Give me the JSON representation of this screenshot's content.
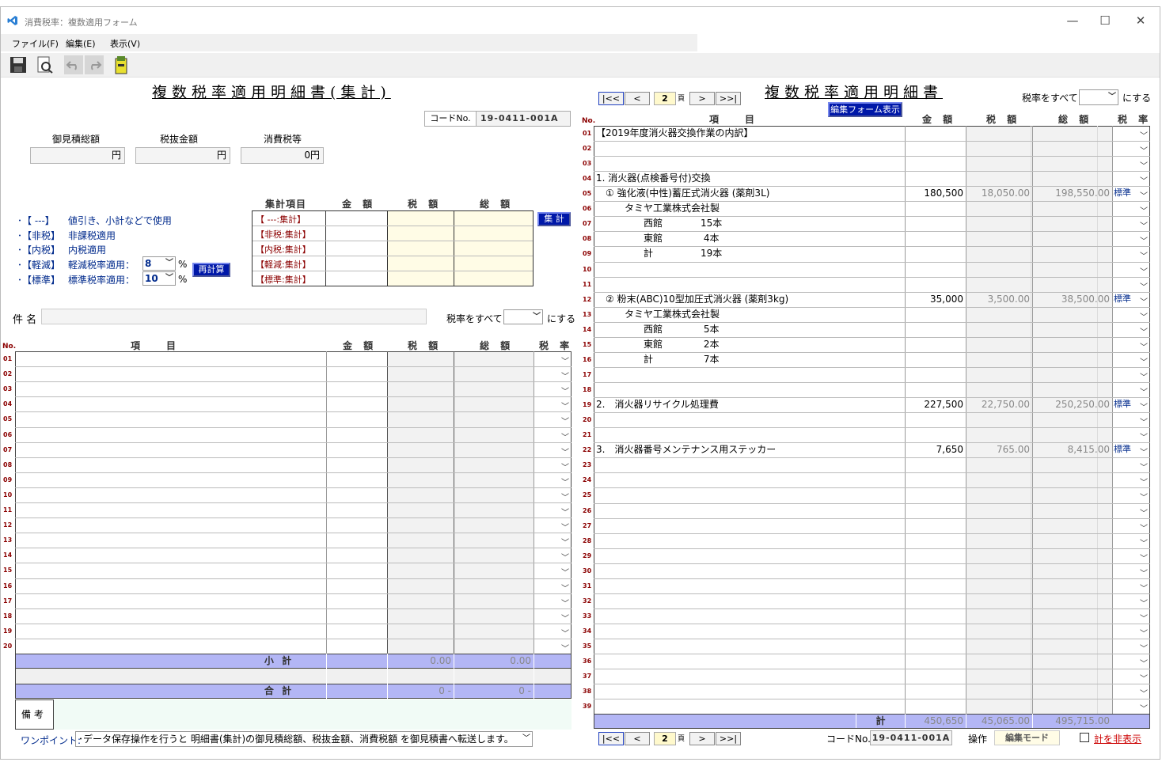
{
  "window": {
    "title": "消費税率：複数適用フォーム",
    "minimize": "—",
    "maximize": "☐",
    "close": "✕"
  },
  "menu": [
    {
      "label": "ファイル(F)"
    },
    {
      "label": "編集(E)"
    },
    {
      "label": "表示(V)"
    }
  ],
  "left": {
    "title": "複数税率適用明細書(集計)",
    "code_label": "コードNo.",
    "code_value": "19-0411-001A",
    "totals": [
      {
        "label": "御見積総額",
        "value": "円"
      },
      {
        "label": "税抜金額",
        "value": "円"
      },
      {
        "label": "消費税等",
        "value": "0円"
      }
    ],
    "legend": [
      {
        "tag": "･【 ---】",
        "desc": "値引き、小計などで使用"
      },
      {
        "tag": "･【非税】",
        "desc": "非課税適用"
      },
      {
        "tag": "･【内税】",
        "desc": "内税適用"
      },
      {
        "tag": "･【軽減】",
        "desc": "軽減税率適用："
      },
      {
        "tag": "･【標準】",
        "desc": "標準税率適用："
      }
    ],
    "reduced_rate": "8",
    "standard_rate": "10",
    "percent": "%",
    "recalc_button": "再計算",
    "summary": {
      "headers": [
        "集計項目",
        "金 額",
        "税 額",
        "総 額"
      ],
      "rows": [
        "【 ---:集計】",
        "【非税:集計】",
        "【内税:集計】",
        "【軽減:集計】",
        "【標準:集計】"
      ],
      "button": "集 計"
    },
    "subject_label": "件 名",
    "subject_value": "",
    "rate_all_label": "税率をすべて",
    "rate_all_suffix": "にする",
    "grid_headers": {
      "no": "No.",
      "item": "項　　目",
      "amount": "金 額",
      "tax": "税 額",
      "total": "総 額",
      "rate": "税 率"
    },
    "row_numbers": [
      "01",
      "02",
      "03",
      "04",
      "05",
      "06",
      "07",
      "08",
      "09",
      "10",
      "11",
      "12",
      "13",
      "14",
      "15",
      "16",
      "17",
      "18",
      "19",
      "20"
    ],
    "subtotal_label": "小 計",
    "subtotal_tax": "0.00",
    "subtotal_total": "0.00",
    "grandtotal_label": "合 計",
    "grandtotal_tax": "0 -",
    "grandtotal_total": "0 -",
    "remarks_label": "備 考",
    "onepoint_label": "ワンポイント:",
    "onepoint_text": "･データ保存操作を行うと 明細書(集計)の御見積総額、税抜金額、消費税額 を御見積書へ転送します。"
  },
  "right": {
    "title": "複数税率適用明細書",
    "nav": {
      "first": "|<<",
      "prev": "<",
      "page": "2",
      "page_unit": "頁",
      "next": ">",
      "last": ">>|"
    },
    "edit_form_button": "編集フォーム表示",
    "rate_all_label": "税率をすべて",
    "rate_all_suffix": "にする",
    "grid_headers": {
      "no": "No.",
      "item": "項　　目",
      "amount": "金 額",
      "tax": "税 額",
      "total": "総 額",
      "rate": "税 率"
    },
    "rows": [
      {
        "no": "01",
        "item": "【2019年度消火器交換作業の内訳】",
        "amount": "",
        "tax": "",
        "total": "",
        "rate": ""
      },
      {
        "no": "02",
        "item": "",
        "amount": "",
        "tax": "",
        "total": "",
        "rate": ""
      },
      {
        "no": "03",
        "item": "",
        "amount": "",
        "tax": "",
        "total": "",
        "rate": ""
      },
      {
        "no": "04",
        "item": "1. 消火器(点検番号付)交換",
        "amount": "",
        "tax": "",
        "total": "",
        "rate": ""
      },
      {
        "no": "05",
        "item": "　① 強化液(中性)蓄圧式消火器 (薬剤3L)",
        "amount": "180,500",
        "tax": "18,050.00",
        "total": "198,550.00",
        "rate": "標準"
      },
      {
        "no": "06",
        "item": "　　　タミヤ工業株式会社製",
        "amount": "",
        "tax": "",
        "total": "",
        "rate": ""
      },
      {
        "no": "07",
        "item": "　　　　　西館　　　　15本",
        "amount": "",
        "tax": "",
        "total": "",
        "rate": ""
      },
      {
        "no": "08",
        "item": "　　　　　東館　　　　 4本",
        "amount": "",
        "tax": "",
        "total": "",
        "rate": ""
      },
      {
        "no": "09",
        "item": "　　　　　計　　　　　19本",
        "amount": "",
        "tax": "",
        "total": "",
        "rate": ""
      },
      {
        "no": "10",
        "item": "",
        "amount": "",
        "tax": "",
        "total": "",
        "rate": ""
      },
      {
        "no": "11",
        "item": "",
        "amount": "",
        "tax": "",
        "total": "",
        "rate": ""
      },
      {
        "no": "12",
        "item": "　② 粉末(ABC)10型加圧式消火器 (薬剤3kg)",
        "amount": "35,000",
        "tax": "3,500.00",
        "total": "38,500.00",
        "rate": "標準"
      },
      {
        "no": "13",
        "item": "　　　タミヤ工業株式会社製",
        "amount": "",
        "tax": "",
        "total": "",
        "rate": ""
      },
      {
        "no": "14",
        "item": "　　　　　西館　　　　 5本",
        "amount": "",
        "tax": "",
        "total": "",
        "rate": ""
      },
      {
        "no": "15",
        "item": "　　　　　東館　　　　 2本",
        "amount": "",
        "tax": "",
        "total": "",
        "rate": ""
      },
      {
        "no": "16",
        "item": "　　　　　計　　　　　 7本",
        "amount": "",
        "tax": "",
        "total": "",
        "rate": ""
      },
      {
        "no": "17",
        "item": "",
        "amount": "",
        "tax": "",
        "total": "",
        "rate": ""
      },
      {
        "no": "18",
        "item": "",
        "amount": "",
        "tax": "",
        "total": "",
        "rate": ""
      },
      {
        "no": "19",
        "item": "2.　消火器リサイクル処理費",
        "amount": "227,500",
        "tax": "22,750.00",
        "total": "250,250.00",
        "rate": "標準"
      },
      {
        "no": "20",
        "item": "",
        "amount": "",
        "tax": "",
        "total": "",
        "rate": ""
      },
      {
        "no": "21",
        "item": "",
        "amount": "",
        "tax": "",
        "total": "",
        "rate": ""
      },
      {
        "no": "22",
        "item": "3.　消火器番号メンテナンス用ステッカー",
        "amount": "7,650",
        "tax": "765.00",
        "total": "8,415.00",
        "rate": "標準"
      },
      {
        "no": "23",
        "item": "",
        "amount": "",
        "tax": "",
        "total": "",
        "rate": ""
      },
      {
        "no": "24",
        "item": "",
        "amount": "",
        "tax": "",
        "total": "",
        "rate": ""
      },
      {
        "no": "25",
        "item": "",
        "amount": "",
        "tax": "",
        "total": "",
        "rate": ""
      },
      {
        "no": "26",
        "item": "",
        "amount": "",
        "tax": "",
        "total": "",
        "rate": ""
      },
      {
        "no": "27",
        "item": "",
        "amount": "",
        "tax": "",
        "total": "",
        "rate": ""
      },
      {
        "no": "28",
        "item": "",
        "amount": "",
        "tax": "",
        "total": "",
        "rate": ""
      },
      {
        "no": "29",
        "item": "",
        "amount": "",
        "tax": "",
        "total": "",
        "rate": ""
      },
      {
        "no": "30",
        "item": "",
        "amount": "",
        "tax": "",
        "total": "",
        "rate": ""
      },
      {
        "no": "31",
        "item": "",
        "amount": "",
        "tax": "",
        "total": "",
        "rate": ""
      },
      {
        "no": "32",
        "item": "",
        "amount": "",
        "tax": "",
        "total": "",
        "rate": ""
      },
      {
        "no": "33",
        "item": "",
        "amount": "",
        "tax": "",
        "total": "",
        "rate": ""
      },
      {
        "no": "34",
        "item": "",
        "amount": "",
        "tax": "",
        "total": "",
        "rate": ""
      },
      {
        "no": "35",
        "item": "",
        "amount": "",
        "tax": "",
        "total": "",
        "rate": ""
      },
      {
        "no": "36",
        "item": "",
        "amount": "",
        "tax": "",
        "total": "",
        "rate": ""
      },
      {
        "no": "37",
        "item": "",
        "amount": "",
        "tax": "",
        "total": "",
        "rate": ""
      },
      {
        "no": "38",
        "item": "",
        "amount": "",
        "tax": "",
        "total": "",
        "rate": ""
      },
      {
        "no": "39",
        "item": "",
        "amount": "",
        "tax": "",
        "total": "",
        "rate": ""
      }
    ],
    "total_label": "計",
    "total_amount": "450,650",
    "total_tax": "45,065.00",
    "total_total": "495,715.00",
    "code_label": "コードNo.",
    "code_value": "19-0411-001A",
    "operation_label": "操作",
    "edit_mode": "編集モード",
    "hide_total_label": "計を非表示"
  },
  "colors": {
    "navy": "#002a8c",
    "maroon": "#8b0000",
    "header_band": "#b3b6f5",
    "yellow_cell": "#fffce6",
    "gray_cell": "#f2f2f2"
  }
}
